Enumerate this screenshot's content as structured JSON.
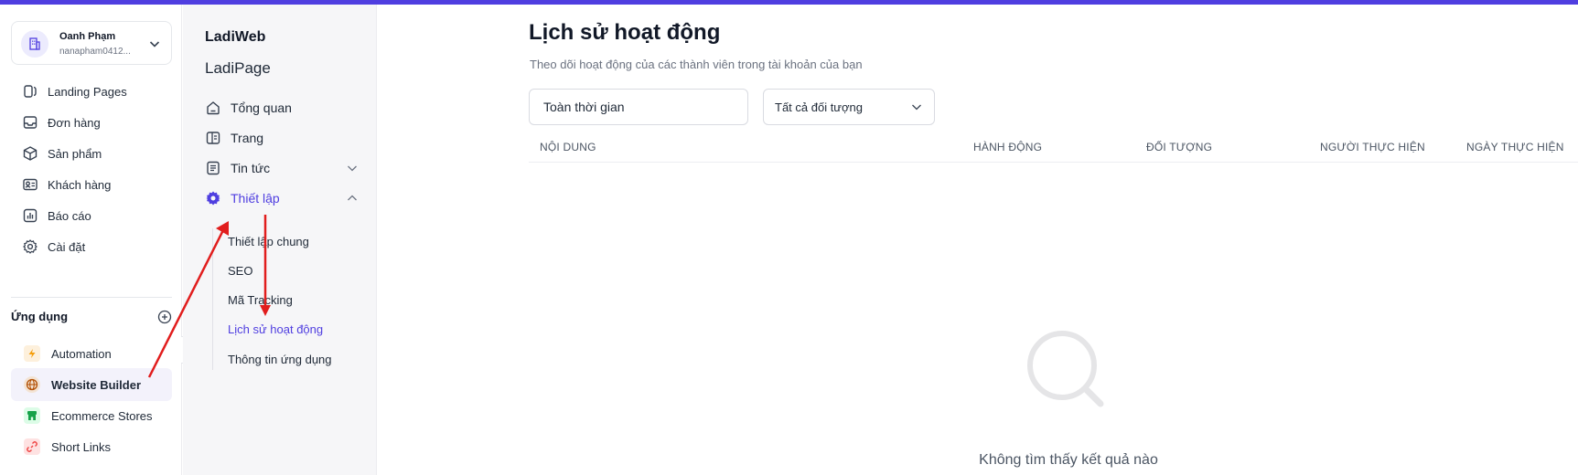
{
  "user": {
    "name": "Oanh Phạm",
    "email": "nanapham0412..."
  },
  "sidebar": {
    "items": [
      {
        "label": "Landing Pages",
        "icon": "layers-icon"
      },
      {
        "label": "Đơn hàng",
        "icon": "inbox-icon"
      },
      {
        "label": "Sản phẩm",
        "icon": "box-icon"
      },
      {
        "label": "Khách hàng",
        "icon": "contact-card-icon"
      },
      {
        "label": "Báo cáo",
        "icon": "chart-icon"
      },
      {
        "label": "Cài đặt",
        "icon": "gear-icon"
      }
    ],
    "apps_title": "Ứng dụng",
    "apps": [
      {
        "label": "Automation",
        "icon": "lightning-icon",
        "color": "#f59e0b"
      },
      {
        "label": "Website Builder",
        "icon": "globe-icon",
        "color": "#b45309"
      },
      {
        "label": "Ecommerce Stores",
        "icon": "store-icon",
        "color": "#16a34a"
      },
      {
        "label": "Short Links",
        "icon": "link-icon",
        "color": "#ef4444"
      }
    ]
  },
  "panel": {
    "brand": "LadiWeb",
    "subtitle": "LadiPage",
    "items": [
      {
        "label": "Tổng quan"
      },
      {
        "label": "Trang"
      },
      {
        "label": "Tin tức"
      },
      {
        "label": "Thiết lập"
      }
    ],
    "sub_items": [
      {
        "label": "Thiết lập chung"
      },
      {
        "label": "SEO"
      },
      {
        "label": "Mã Tracking"
      },
      {
        "label": "Lịch sử hoạt động"
      },
      {
        "label": "Thông tin ứng dụng"
      }
    ]
  },
  "main": {
    "title": "Lịch sử hoạt động",
    "subtitle": "Theo dõi hoạt động của các thành viên trong tài khoản của bạn",
    "time_filter": "Toàn thời gian",
    "object_filter": "Tất cả đối tượng",
    "columns": [
      "NỘI DUNG",
      "HÀNH ĐỘNG",
      "ĐỐI TƯỢNG",
      "NGƯỜI THỰC HIỆN",
      "NGÀY THỰC HIỆN"
    ],
    "empty_text": "Không tìm thấy kết quả nào"
  },
  "colors": {
    "accent": "#4f3ee0",
    "annotation": "#e11d1d"
  }
}
